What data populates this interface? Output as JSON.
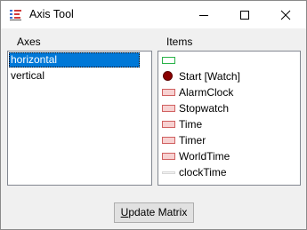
{
  "window": {
    "title": "Axis Tool",
    "icons": {
      "app": "axis-tool-icon",
      "minimize": "minimize-icon",
      "maximize": "maximize-icon",
      "close": "close-icon"
    }
  },
  "axes": {
    "label": "Axes",
    "items": [
      {
        "label": "horizontal",
        "selected": true
      },
      {
        "label": "vertical",
        "selected": false
      }
    ]
  },
  "items": {
    "label": "Items",
    "entries": [
      {
        "label": "",
        "icon": "green-outline-swatch"
      },
      {
        "label": "Start [Watch]",
        "icon": "dark-red-dot-icon"
      },
      {
        "label": "AlarmClock",
        "icon": "red-swatch"
      },
      {
        "label": "Stopwatch",
        "icon": "red-swatch"
      },
      {
        "label": "Time",
        "icon": "red-swatch"
      },
      {
        "label": "Timer",
        "icon": "red-swatch"
      },
      {
        "label": "WorldTime",
        "icon": "red-swatch"
      },
      {
        "label": "clockTime",
        "icon": "thin-line-swatch"
      }
    ]
  },
  "button": {
    "accel": "U",
    "rest": "pdate Matrix"
  },
  "colors": {
    "selection": "#0078d7",
    "dot": "#8a0000",
    "swatch_red": "#f7d2d2",
    "swatch_green": "#2bb34a"
  }
}
